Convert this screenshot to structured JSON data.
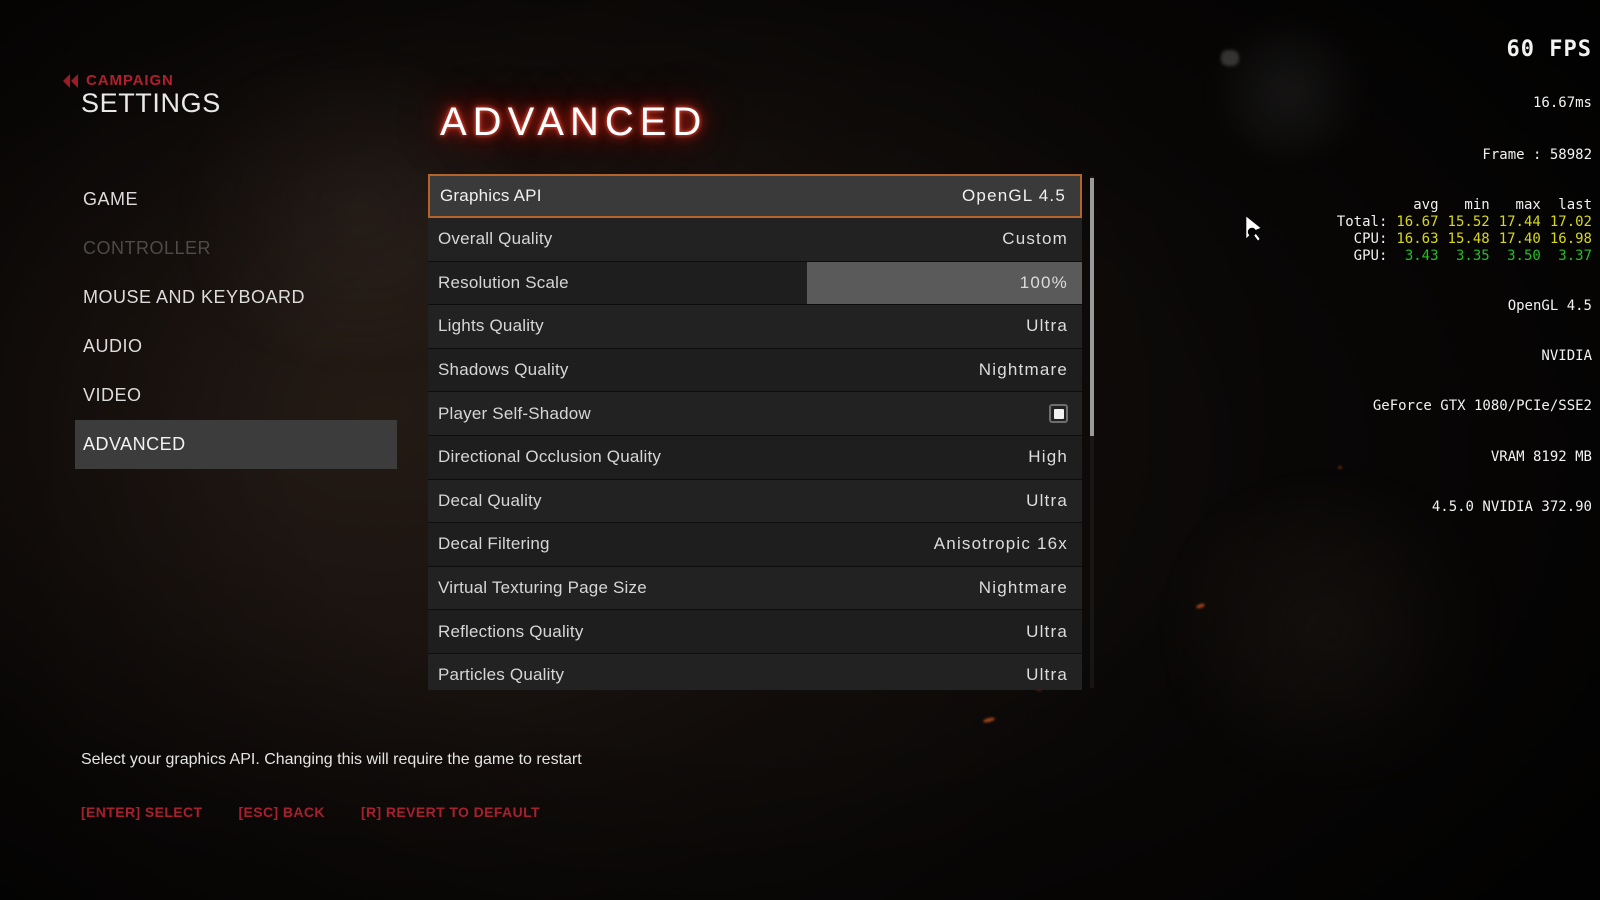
{
  "header": {
    "breadcrumb_label": "CAMPAIGN",
    "back_icon": "double-chevron-left-icon",
    "settings_title": "SETTINGS",
    "page_title": "ADVANCED"
  },
  "sidebar": {
    "items": [
      {
        "label": "GAME",
        "state": "normal"
      },
      {
        "label": "CONTROLLER",
        "state": "disabled"
      },
      {
        "label": "MOUSE AND KEYBOARD",
        "state": "normal"
      },
      {
        "label": "AUDIO",
        "state": "normal"
      },
      {
        "label": "VIDEO",
        "state": "normal"
      },
      {
        "label": "ADVANCED",
        "state": "active"
      }
    ]
  },
  "settings": {
    "rows": [
      {
        "label": "Graphics API",
        "value": "OpenGL 4.5",
        "type": "option",
        "selected": true
      },
      {
        "label": "Overall Quality",
        "value": "Custom",
        "type": "option",
        "selected": false
      },
      {
        "label": "Resolution Scale",
        "value": "100%",
        "type": "slider",
        "selected": false,
        "fill_percent": 42
      },
      {
        "label": "Lights Quality",
        "value": "Ultra",
        "type": "option",
        "selected": false
      },
      {
        "label": "Shadows Quality",
        "value": "Nightmare",
        "type": "option",
        "selected": false
      },
      {
        "label": "Player Self-Shadow",
        "value": "",
        "type": "checkbox",
        "selected": false,
        "checked": true
      },
      {
        "label": "Directional Occlusion Quality",
        "value": "High",
        "type": "option",
        "selected": false
      },
      {
        "label": "Decal Quality",
        "value": "Ultra",
        "type": "option",
        "selected": false
      },
      {
        "label": "Decal Filtering",
        "value": "Anisotropic 16x",
        "type": "option",
        "selected": false
      },
      {
        "label": "Virtual Texturing Page Size",
        "value": "Nightmare",
        "type": "option",
        "selected": false
      },
      {
        "label": "Reflections Quality",
        "value": "Ultra",
        "type": "option",
        "selected": false
      },
      {
        "label": "Particles Quality",
        "value": "Ultra",
        "type": "option",
        "selected": false
      }
    ]
  },
  "footer": {
    "help_text": "Select your graphics API. Changing this will require the game to restart",
    "hints": [
      "[ENTER] SELECT",
      "[ESC] BACK",
      "[R] REVERT TO DEFAULT"
    ]
  },
  "perf_overlay": {
    "fps": "60 FPS",
    "frametime": "16.67ms",
    "frame": "Frame : 58982",
    "columns": [
      "avg",
      "min",
      "max",
      "last"
    ],
    "rows": [
      {
        "name": "Total:",
        "values": [
          "16.67",
          "15.52",
          "17.44",
          "17.02"
        ],
        "color": "#d8d818"
      },
      {
        "name": "CPU:",
        "values": [
          "16.63",
          "15.48",
          "17.40",
          "16.98"
        ],
        "color": "#d8d818"
      },
      {
        "name": "GPU:",
        "values": [
          "3.43",
          "3.35",
          "3.50",
          "3.37"
        ],
        "color": "#20c020"
      }
    ],
    "api": "OpenGL 4.5",
    "vendor": "NVIDIA",
    "renderer": "GeForce GTX 1080/PCIe/SSE2",
    "vram": "VRAM 8192 MB",
    "driver": "4.5.0 NVIDIA 372.90"
  },
  "colors": {
    "accent_red": "#b01f2c",
    "selection_border": "#b4632c",
    "active_nav_bg": "#3c3c3c",
    "row_bg": "#1e1e1e",
    "slider_fill": "#5a5a5a"
  },
  "cursor": {
    "icon": "game-pointer-cursor"
  }
}
